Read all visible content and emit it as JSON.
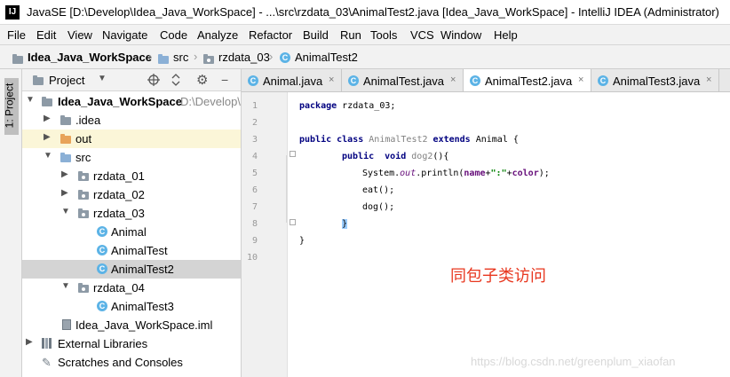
{
  "window": {
    "title": "JavaSE [D:\\Develop\\Idea_Java_WorkSpace] - ...\\src\\rzdata_03\\AnimalTest2.java [Idea_Java_WorkSpace] - IntelliJ IDEA (Administrator)"
  },
  "menu": [
    "File",
    "Edit",
    "View",
    "Navigate",
    "Code",
    "Analyze",
    "Refactor",
    "Build",
    "Run",
    "Tools",
    "VCS",
    "Window",
    "Help"
  ],
  "breadcrumb": [
    "Idea_Java_WorkSpace",
    "src",
    "rzdata_03",
    "AnimalTest2"
  ],
  "side_tab": "1: Project",
  "project_panel": {
    "title": "Project",
    "tree": [
      {
        "label": "Idea_Java_WorkSpace",
        "path": "D:\\Develop\\I",
        "icon": "module",
        "depth": 0,
        "arrow": "open"
      },
      {
        "label": ".idea",
        "icon": "folder",
        "depth": 1,
        "arrow": "closed"
      },
      {
        "label": "out",
        "icon": "folder-orange",
        "depth": 1,
        "arrow": "closed"
      },
      {
        "label": "src",
        "icon": "folder-blue",
        "depth": 1,
        "arrow": "open"
      },
      {
        "label": "rzdata_01",
        "icon": "package",
        "depth": 2,
        "arrow": "closed"
      },
      {
        "label": "rzdata_02",
        "icon": "package",
        "depth": 2,
        "arrow": "closed"
      },
      {
        "label": "rzdata_03",
        "icon": "package",
        "depth": 2,
        "arrow": "open"
      },
      {
        "label": "Animal",
        "icon": "class",
        "depth": 3,
        "arrow": "none"
      },
      {
        "label": "AnimalTest",
        "icon": "class",
        "depth": 3,
        "arrow": "none"
      },
      {
        "label": "AnimalTest2",
        "icon": "class",
        "depth": 3,
        "arrow": "none"
      },
      {
        "label": "rzdata_04",
        "icon": "package",
        "depth": 2,
        "arrow": "open"
      },
      {
        "label": "AnimalTest3",
        "icon": "class",
        "depth": 3,
        "arrow": "none"
      },
      {
        "label": "Idea_Java_WorkSpace.iml",
        "icon": "iml",
        "depth": 1,
        "arrow": "none"
      },
      {
        "label": "External Libraries",
        "icon": "libraries",
        "depth": 0,
        "arrow": "closed"
      },
      {
        "label": "Scratches and Consoles",
        "icon": "scratches",
        "depth": 0,
        "arrow": "none"
      }
    ],
    "selected": "AnimalTest2",
    "highlighted": "out"
  },
  "tabs": [
    {
      "label": "Animal.java",
      "active": false
    },
    {
      "label": "AnimalTest.java",
      "active": false
    },
    {
      "label": "AnimalTest2.java",
      "active": true
    },
    {
      "label": "AnimalTest3.java",
      "active": false
    }
  ],
  "tab_close": "×",
  "class_letter": "C",
  "editor": {
    "line_numbers": [
      "1",
      "2",
      "3",
      "4",
      "5",
      "6",
      "7",
      "8",
      "9",
      "10"
    ],
    "code": {
      "l1": {
        "kw": "package",
        "rest": " rzdata_03;"
      },
      "l3": {
        "kw1": "public class",
        "name": "AnimalTest2",
        "kw2": "extends",
        "rest": " Animal {"
      },
      "l4": {
        "kw": "public  void",
        "name": "dog2",
        "rest": "(){"
      },
      "l5": {
        "a": "System.",
        "b": "out",
        "c": ".println(",
        "d": "name",
        "e": "+",
        "f": "\":\"",
        "g": "+",
        "h": "color",
        "i": ");"
      },
      "l6": "eat();",
      "l7": "dog();",
      "l8": "}",
      "l9": "}"
    },
    "annotation": "同包子类访问"
  },
  "watermark": "https://blog.csdn.net/greenplum_xiaofan",
  "colors": {
    "keyword": "#000080",
    "field": "#660e7a",
    "string": "#008000",
    "annotation": "#e8371f"
  }
}
